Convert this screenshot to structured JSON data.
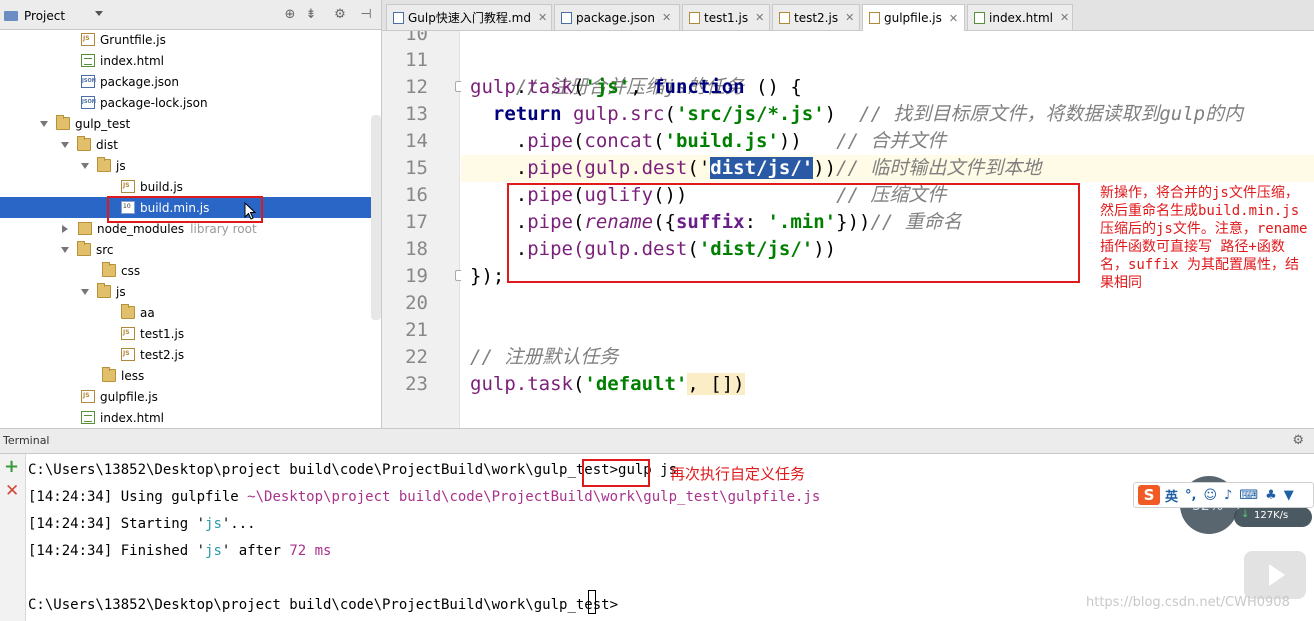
{
  "project_panel": {
    "dropdown_label": "Project",
    "tree": [
      {
        "label": "Gruntfile.js",
        "type": "js"
      },
      {
        "label": "index.html",
        "type": "html"
      },
      {
        "label": "package.json",
        "type": "json"
      },
      {
        "label": "package-lock.json",
        "type": "json"
      },
      {
        "label": "gulp_test",
        "type": "folder"
      },
      {
        "label": "dist",
        "type": "folder"
      },
      {
        "label": "js",
        "type": "folder"
      },
      {
        "label": "build.js",
        "type": "js"
      },
      {
        "label": "build.min.js",
        "type": "min",
        "selected": true
      },
      {
        "label": "node_modules",
        "type": "folder",
        "suffix": "library root"
      },
      {
        "label": "src",
        "type": "folder"
      },
      {
        "label": "css",
        "type": "folder"
      },
      {
        "label": "js",
        "type": "folder"
      },
      {
        "label": "aa",
        "type": "folder"
      },
      {
        "label": "test1.js",
        "type": "js"
      },
      {
        "label": "test2.js",
        "type": "js"
      },
      {
        "label": "less",
        "type": "folder"
      },
      {
        "label": "gulpfile.js",
        "type": "js"
      },
      {
        "label": "index.html",
        "type": "html"
      }
    ]
  },
  "editor": {
    "tabs": [
      {
        "label": "Gulp快速入门教程.md",
        "icon": "md",
        "active": false
      },
      {
        "label": "package.json",
        "icon": "json",
        "active": false
      },
      {
        "label": "test1.js",
        "icon": "js",
        "active": false
      },
      {
        "label": "test2.js",
        "icon": "js",
        "active": false
      },
      {
        "label": "gulpfile.js",
        "icon": "js",
        "active": true
      },
      {
        "label": "index.html",
        "icon": "html",
        "active": false
      }
    ],
    "line_numbers": [
      "10",
      "11",
      "12",
      "13",
      "14",
      "15",
      "16",
      "17",
      "18",
      "19",
      "20",
      "21",
      "22",
      "23"
    ],
    "code": {
      "l11_comment": "// 注册合并压缩js的任务",
      "l12_obj": "gulp",
      "l12_dot": ".",
      "l12_method": "task",
      "l12_open": "(",
      "l12_str": "'js'",
      "l12_comma": ", ",
      "l12_kw": "function",
      "l12_rest": " () {",
      "l13_kw": "return",
      "l13_obj": " gulp.",
      "l13_method": "src",
      "l13_open": "(",
      "l13_str": "'src/js/*.js'",
      "l13_close": ")  ",
      "l13_comment": "// 找到目标原文件，将数据读取到gulp的内",
      "l14_pre": "    .",
      "l14_method": "pipe",
      "l14_open": "(",
      "l14_fn": "concat",
      "l14_open2": "(",
      "l14_str": "'build.js'",
      "l14_close": "))   ",
      "l14_comment": "// 合并文件",
      "l15_pre": "    .",
      "l15_method": "pipe",
      "l15_open": "(gulp.",
      "l15_fn": "dest",
      "l15_open2": "('",
      "l15_sel": "dist/js/'",
      "l15_close": "))",
      "l15_comment": "// 临时输出文件到本地",
      "l16_pre": "    .",
      "l16_method": "pipe",
      "l16_open": "(",
      "l16_fn": "uglify",
      "l16_close": "())             ",
      "l16_comment": "// 压缩文件",
      "l17_pre": "    .",
      "l17_method": "pipe",
      "l17_open": "(",
      "l17_fn": "rename",
      "l17_open2": "({",
      "l17_prop": "suffix",
      "l17_colon": ": ",
      "l17_str": "'.min'",
      "l17_close": "}))",
      "l17_comment": "// 重命名",
      "l18_pre": "    .",
      "l18_method": "pipe",
      "l18_open": "(gulp.",
      "l18_fn": "dest",
      "l18_open2": "(",
      "l18_str": "'dist/js/'",
      "l18_close": "))",
      "l19": "});",
      "l22_comment": "// 注册默认任务",
      "l23_obj": "gulp.",
      "l23_method": "task",
      "l23_open": "(",
      "l23_str": "'default'",
      "l23_rest": ", [])"
    },
    "annotation": "新操作，将合并的js文件压缩，然后重命名生成build.min.js压缩后的js文件。注意，rename 插件函数可直接写  路径+函数名，suffix 为其配置属性，结果相同"
  },
  "terminal": {
    "title": "Terminal",
    "prompt1": "C:\\Users\\13852\\Desktop\\project build\\code\\ProjectBuild\\work\\gulp_test>",
    "command": "gulp js",
    "command_annotation": "再次执行自定义任务",
    "line2_time": "[14:24:34] Using gulpfile ",
    "line2_path": "~\\Desktop\\project build\\code\\ProjectBuild\\work\\gulp_test\\gulpfile.js",
    "line3_time": "[14:24:34] Starting '",
    "line3_task": "js",
    "line3_end": "'...",
    "line4_time": "[14:24:34] Finished '",
    "line4_task": "js",
    "line4_mid": "' after ",
    "line4_num": "72 ms",
    "prompt2": "C:\\Users\\13852\\Desktop\\project build\\code\\ProjectBuild\\work\\gulp_test>"
  },
  "ime": {
    "logo": "S",
    "lang": "英",
    "percent": "32%",
    "rate": "127K/s"
  },
  "watermark": "https://blog.csdn.net/CWH0908"
}
